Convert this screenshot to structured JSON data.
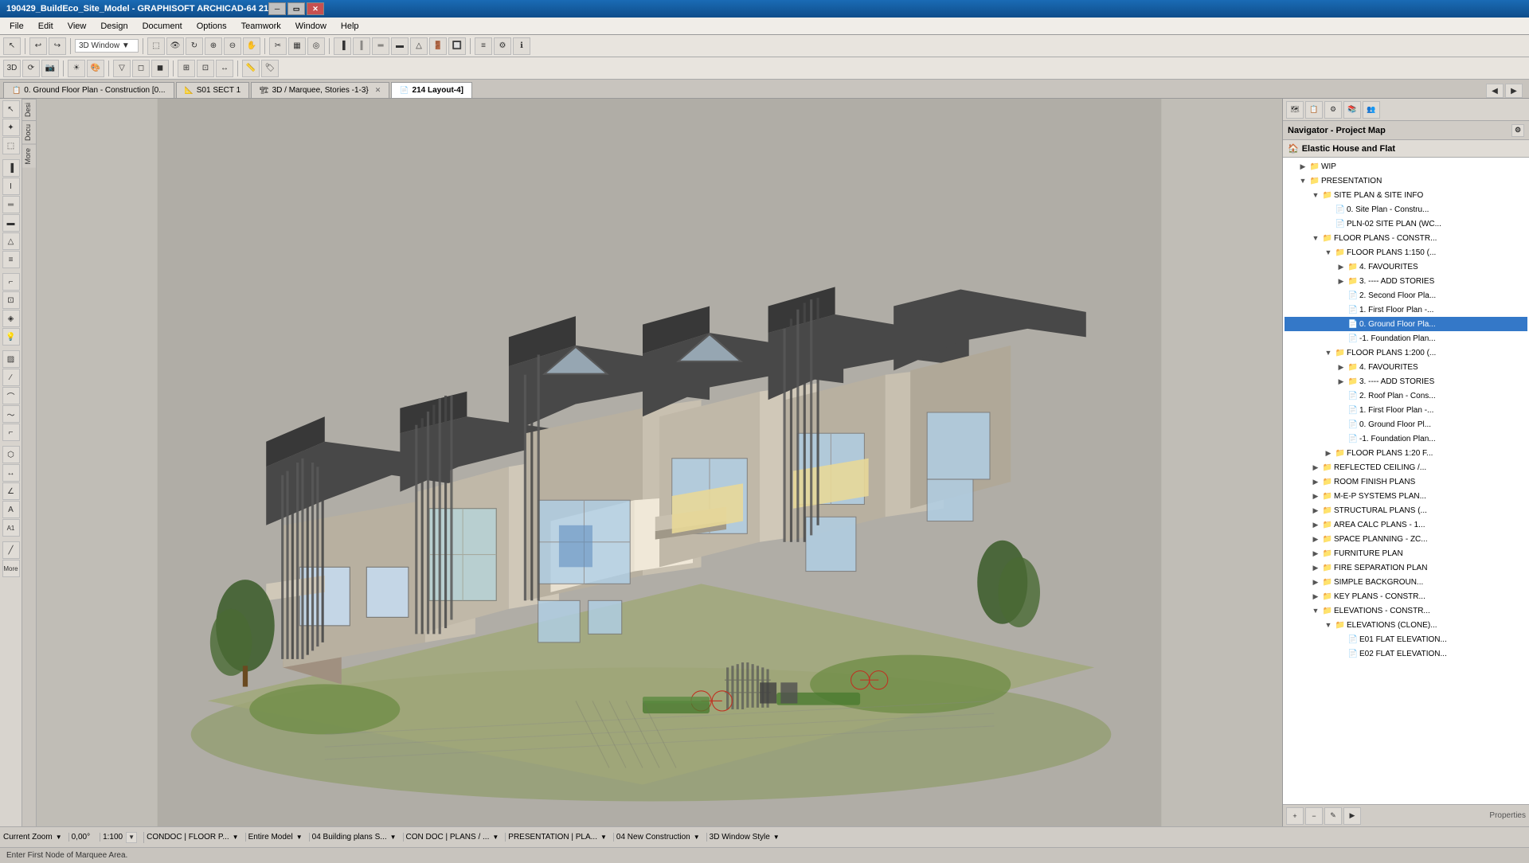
{
  "app": {
    "title": "190429_BuildEco_Site_Model - GRAPHISOFT ARCHICAD-64 21",
    "titlebar_controls": [
      "minimize",
      "restore",
      "close"
    ]
  },
  "menu": {
    "items": [
      "File",
      "Edit",
      "View",
      "Design",
      "Document",
      "Options",
      "Teamwork",
      "Window",
      "Help"
    ]
  },
  "tabs": [
    {
      "id": "tab1",
      "label": "0. Ground Floor Plan - Construction [0...",
      "icon": "📋",
      "active": false,
      "closable": false
    },
    {
      "id": "tab2",
      "label": "S01 SECT 1",
      "icon": "📐",
      "active": false,
      "closable": false
    },
    {
      "id": "tab3",
      "label": "3D / Marquee, Stories -1-3}",
      "icon": "🏗",
      "active": false,
      "closable": true
    },
    {
      "id": "tab4",
      "label": "214 Layout-4]",
      "icon": "📄",
      "active": true,
      "closable": false
    }
  ],
  "toolbar1": {
    "active_window_label": "3D Window",
    "buttons": [
      "arrow",
      "undo",
      "redo",
      "new",
      "open",
      "save",
      "print",
      "cut",
      "copy",
      "paste"
    ]
  },
  "viewport": {
    "background_color": "#b8b5ae",
    "building_description": "3D isometric view of Elastic House and Flat multi-unit residential building"
  },
  "right_panel": {
    "title": "Properties",
    "active_tab": "Navigator",
    "tabs": [
      "Navigator",
      "Properties"
    ],
    "project_title": "Elastic House and Flat",
    "wip_label": "WIP",
    "tree": [
      {
        "level": 0,
        "type": "project",
        "label": "Elastic House and Flat",
        "expanded": true,
        "icon": "🏠"
      },
      {
        "level": 1,
        "type": "folder",
        "label": "WIP",
        "expanded": false,
        "icon": "📁"
      },
      {
        "level": 1,
        "type": "folder",
        "label": "PRESENTATION",
        "expanded": true,
        "icon": "📁"
      },
      {
        "level": 2,
        "type": "folder",
        "label": "SITE PLAN & SITE INFO",
        "expanded": true,
        "icon": "📁"
      },
      {
        "level": 3,
        "type": "doc",
        "label": "0. Site Plan - Constru...",
        "icon": "📄"
      },
      {
        "level": 3,
        "type": "doc",
        "label": "PLN-02 SITE PLAN (WC...",
        "icon": "📄"
      },
      {
        "level": 2,
        "type": "folder",
        "label": "FLOOR PLANS - CONSTR...",
        "expanded": true,
        "icon": "📁"
      },
      {
        "level": 3,
        "type": "folder",
        "label": "FLOOR PLANS 1:150 (...",
        "expanded": true,
        "icon": "📁"
      },
      {
        "level": 4,
        "type": "folder",
        "label": "4. FAVOURITES",
        "expanded": false,
        "icon": "📁"
      },
      {
        "level": 4,
        "type": "folder",
        "label": "3. ---- ADD STORIES",
        "expanded": false,
        "icon": "📁"
      },
      {
        "level": 4,
        "type": "doc",
        "label": "2. Second Floor Pla...",
        "icon": "📄"
      },
      {
        "level": 4,
        "type": "doc",
        "label": "1. First Floor Plan -...",
        "icon": "📄"
      },
      {
        "level": 4,
        "type": "doc",
        "label": "0. Ground Floor Pla...",
        "icon": "📄",
        "selected": true
      },
      {
        "level": 4,
        "type": "doc",
        "label": "-1. Foundation Plan...",
        "icon": "📄"
      },
      {
        "level": 3,
        "type": "folder",
        "label": "FLOOR PLANS 1:200 (...",
        "expanded": true,
        "icon": "📁"
      },
      {
        "level": 4,
        "type": "folder",
        "label": "4. FAVOURITES",
        "expanded": false,
        "icon": "📁"
      },
      {
        "level": 4,
        "type": "folder",
        "label": "3. ---- ADD STORIES",
        "expanded": false,
        "icon": "📁"
      },
      {
        "level": 4,
        "type": "doc",
        "label": "2. Roof Plan - Cons...",
        "icon": "📄"
      },
      {
        "level": 4,
        "type": "doc",
        "label": "1. First Floor Plan -...",
        "icon": "📄"
      },
      {
        "level": 4,
        "type": "doc",
        "label": "0. Ground Floor Pl...",
        "icon": "📄"
      },
      {
        "level": 4,
        "type": "doc",
        "label": "-1. Foundation Plan...",
        "icon": "📄"
      },
      {
        "level": 3,
        "type": "folder",
        "label": "FLOOR PLANS 1:20 F...",
        "expanded": false,
        "icon": "📁"
      },
      {
        "level": 2,
        "type": "folder",
        "label": "REFLECTED CEILING /...",
        "expanded": false,
        "icon": "📁"
      },
      {
        "level": 2,
        "type": "folder",
        "label": "ROOM FINISH PLANS",
        "expanded": false,
        "icon": "📁"
      },
      {
        "level": 2,
        "type": "folder",
        "label": "M-E-P SYSTEMS PLAN...",
        "expanded": false,
        "icon": "📁"
      },
      {
        "level": 2,
        "type": "folder",
        "label": "STRUCTURAL PLANS (...",
        "expanded": false,
        "icon": "📁"
      },
      {
        "level": 2,
        "type": "folder",
        "label": "AREA CALC PLANS - 1...",
        "expanded": false,
        "icon": "📁"
      },
      {
        "level": 2,
        "type": "folder",
        "label": "SPACE PLANNING - ZC...",
        "expanded": false,
        "icon": "📁"
      },
      {
        "level": 2,
        "type": "folder",
        "label": "FURNITURE PLAN",
        "expanded": false,
        "icon": "📁"
      },
      {
        "level": 2,
        "type": "folder",
        "label": "FIRE SEPARATION PLAN",
        "expanded": false,
        "icon": "📁"
      },
      {
        "level": 2,
        "type": "folder",
        "label": "SIMPLE BACKGROUN...",
        "expanded": false,
        "icon": "📁"
      },
      {
        "level": 2,
        "type": "folder",
        "label": "KEY PLANS - CONSTR...",
        "expanded": false,
        "icon": "📁"
      },
      {
        "level": 2,
        "type": "folder",
        "label": "ELEVATIONS - CONSTR...",
        "expanded": true,
        "icon": "📁"
      },
      {
        "level": 3,
        "type": "folder",
        "label": "ELEVATIONS (CLONE)...",
        "expanded": true,
        "icon": "📁"
      },
      {
        "level": 4,
        "type": "doc",
        "label": "E01 FLAT ELEVATION...",
        "icon": "📄"
      },
      {
        "level": 4,
        "type": "doc",
        "label": "E02 FLAT ELEVATION...",
        "icon": "📄"
      }
    ]
  },
  "statusbar": {
    "info_text": "Enter First Node of Marquee Area.",
    "zoom_label": "Current Zoom",
    "zoom_value": "0,00°",
    "scale": "1:100",
    "condoc": "CONDOC | FLOOR P...",
    "model": "Entire Model",
    "building_plans": "04 Building plans S...",
    "con_doc": "CON DOC | PLANS / ...",
    "presentation": "PRESENTATION | PLA...",
    "new_construction": "04 New Construction",
    "window_style": "3D Window Style"
  },
  "left_labels": [
    "Desi",
    "Docu",
    "More"
  ],
  "panel_bottom_label": "Properties"
}
